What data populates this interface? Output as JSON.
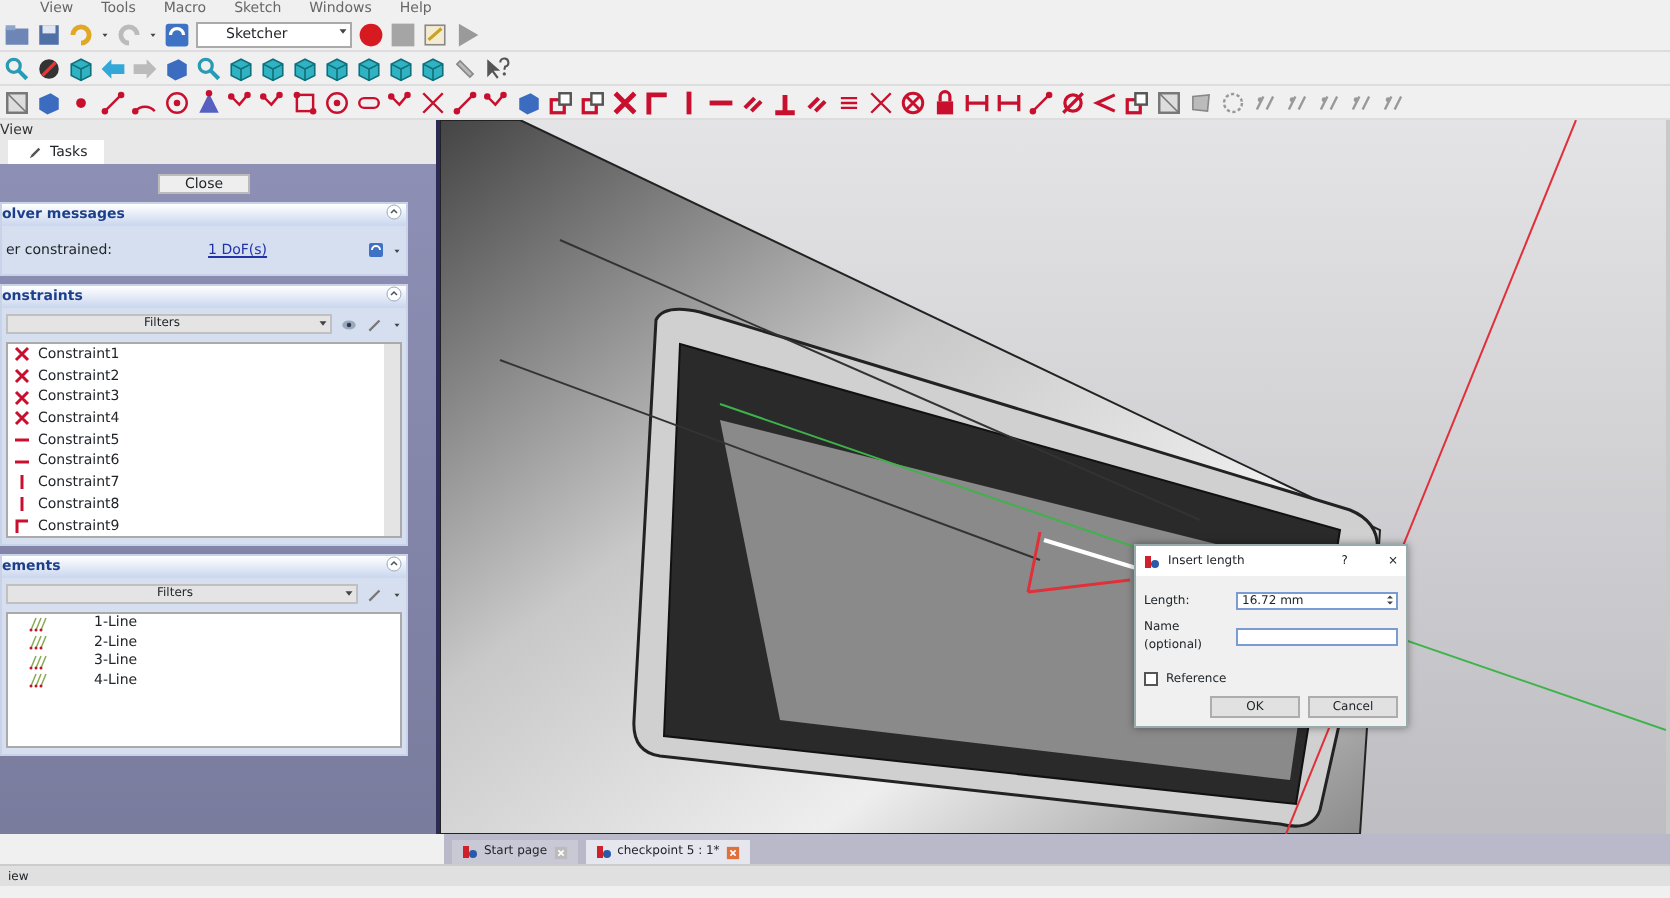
{
  "menu": [
    "View",
    "Tools",
    "Macro",
    "Sketch",
    "Windows",
    "Help"
  ],
  "workbench": "Sketcher",
  "panel": {
    "title": "View",
    "tab": "Tasks",
    "close": "Close",
    "solver": {
      "title": "olver messages",
      "label": "er constrained:",
      "link": "1 DoF(s)",
      "expanded": true
    },
    "constraints": {
      "title": "onstraints",
      "filter": "Filters",
      "expanded": true,
      "items": [
        {
          "label": "Constraint1",
          "kind": "coincident"
        },
        {
          "label": "Constraint2",
          "kind": "coincident"
        },
        {
          "label": "Constraint3",
          "kind": "coincident"
        },
        {
          "label": "Constraint4",
          "kind": "coincident"
        },
        {
          "label": "Constraint5",
          "kind": "horizontal"
        },
        {
          "label": "Constraint6",
          "kind": "horizontal"
        },
        {
          "label": "Constraint7",
          "kind": "vertical"
        },
        {
          "label": "Constraint8",
          "kind": "vertical"
        },
        {
          "label": "Constraint9",
          "kind": "corner"
        }
      ]
    },
    "elements": {
      "title": "ements",
      "filter": "Filters",
      "expanded": true,
      "items": [
        "1-Line",
        "2-Line",
        "3-Line",
        "4-Line"
      ]
    }
  },
  "dialog": {
    "title": "Insert length",
    "help": "?",
    "close": "×",
    "length_label": "Length:",
    "length_value": "16.72 mm",
    "name_label": "Name (optional)",
    "reference": {
      "label": "Reference",
      "checked": false
    },
    "buttons": [
      "OK",
      "Cancel"
    ]
  },
  "doc_tabs": [
    {
      "label": "Start page",
      "selected": false
    },
    {
      "label": "checkpoint 5 : 1*",
      "selected": true
    }
  ],
  "report": {
    "title": "iew"
  }
}
